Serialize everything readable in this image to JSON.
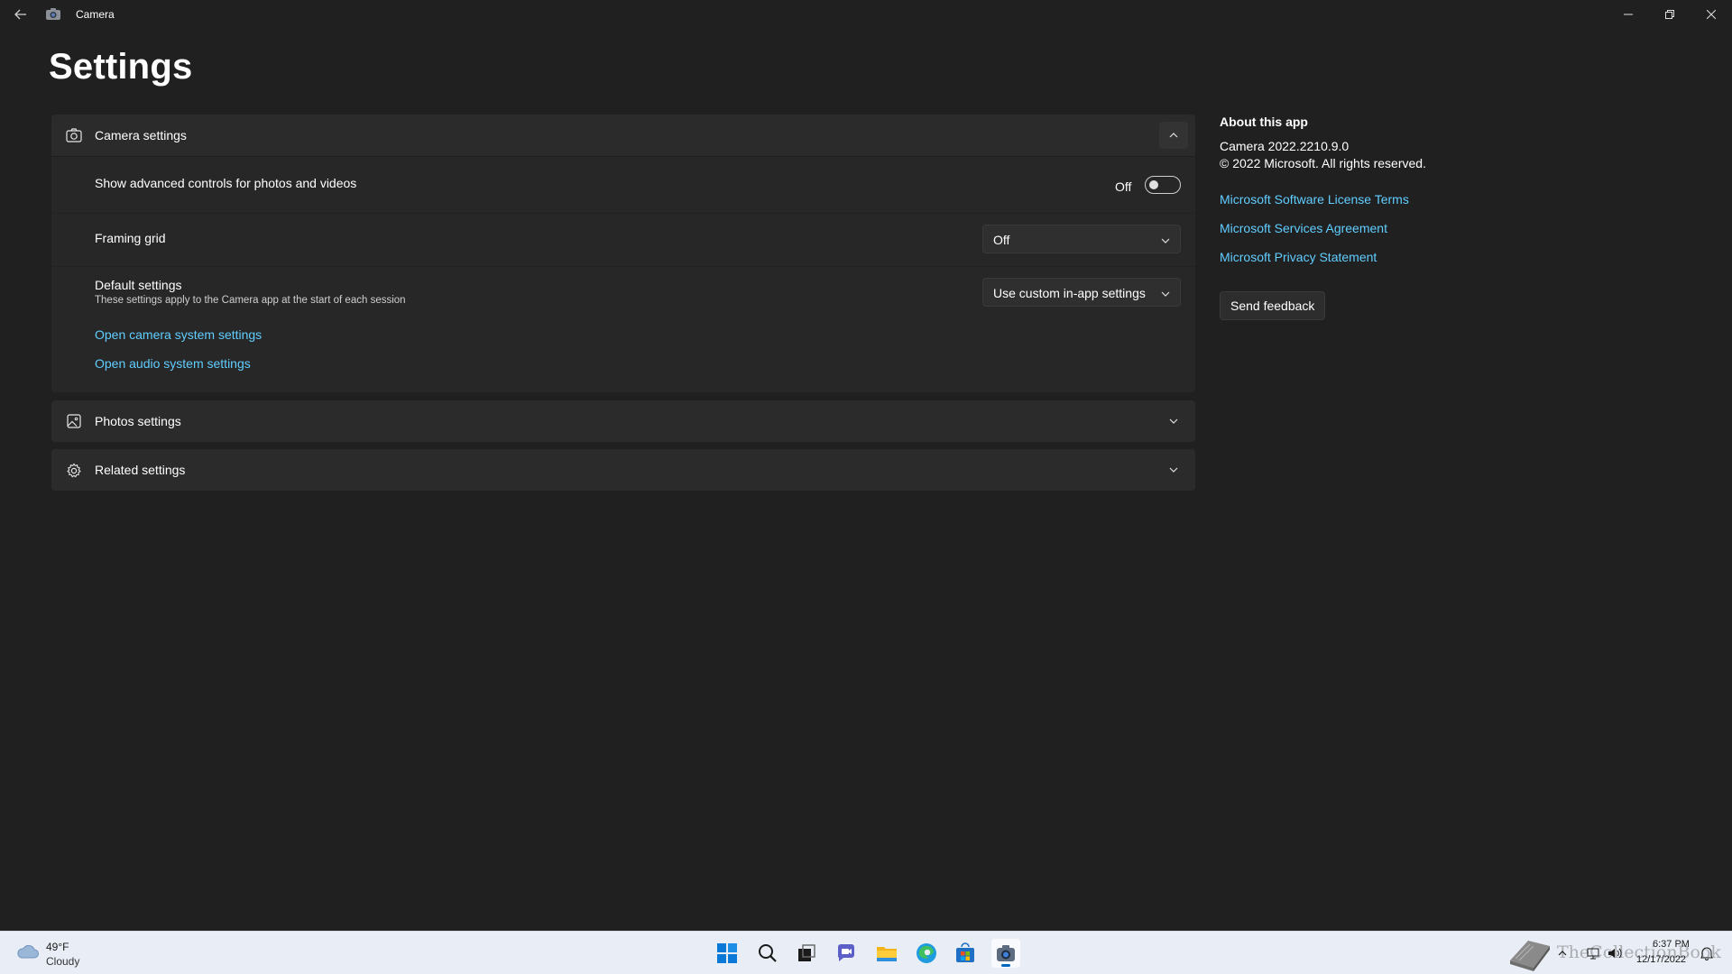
{
  "window": {
    "app_title": "Camera",
    "back_icon": "back-arrow-icon",
    "app_icon": "camera-icon",
    "controls": [
      "minimize-icon",
      "restore-icon",
      "close-icon"
    ]
  },
  "page": {
    "title": "Settings"
  },
  "camera_settings": {
    "label": "Camera settings",
    "expanded": true,
    "advanced_controls": {
      "label": "Show advanced controls for photos and videos",
      "state_text": "Off",
      "on": false
    },
    "framing_grid": {
      "label": "Framing grid",
      "value": "Off"
    },
    "default_settings": {
      "label": "Default settings",
      "description": "These settings apply to the Camera app at the start of each session",
      "value": "Use custom in-app settings"
    },
    "links": [
      "Open camera system settings",
      "Open audio system settings"
    ]
  },
  "photos_settings": {
    "label": "Photos settings",
    "expanded": false
  },
  "related_settings": {
    "label": "Related settings",
    "expanded": false
  },
  "about": {
    "title": "About this app",
    "version_line": "Camera  2022.2210.9.0",
    "copyright": "© 2022 Microsoft. All rights reserved.",
    "links": [
      "Microsoft Software License Terms",
      "Microsoft Services Agreement",
      "Microsoft Privacy Statement"
    ],
    "feedback_button": "Send feedback"
  },
  "taskbar": {
    "weather": {
      "temp": "49°F",
      "desc": "Cloudy"
    },
    "apps": [
      "start-icon",
      "search-icon",
      "task-view-icon",
      "teams-chat-icon",
      "file-explorer-icon",
      "edge-icon",
      "store-icon",
      "camera-icon"
    ],
    "active_app": "camera-icon",
    "clock": {
      "time": "6:37 PM",
      "date": "12/17/2022"
    },
    "watermark": "TheCollectionBook"
  },
  "colors": {
    "background": "#202020",
    "card": "#2b2b2b",
    "link": "#60cdff",
    "taskbar": "#e9eef6"
  }
}
